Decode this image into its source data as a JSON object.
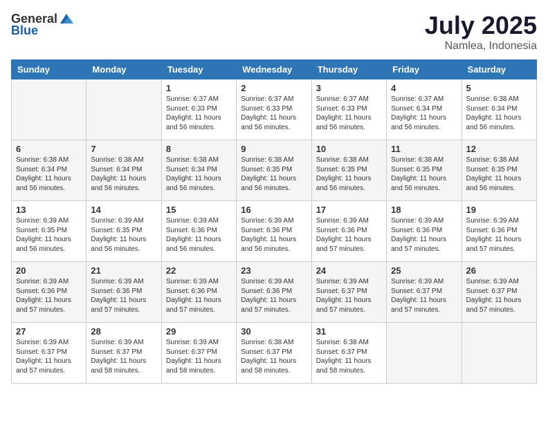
{
  "header": {
    "logo_general": "General",
    "logo_blue": "Blue",
    "month": "July 2025",
    "location": "Namlea, Indonesia"
  },
  "weekdays": [
    "Sunday",
    "Monday",
    "Tuesday",
    "Wednesday",
    "Thursday",
    "Friday",
    "Saturday"
  ],
  "weeks": [
    [
      {
        "day": "",
        "info": ""
      },
      {
        "day": "",
        "info": ""
      },
      {
        "day": "1",
        "info": "Sunrise: 6:37 AM\nSunset: 6:33 PM\nDaylight: 11 hours and 56 minutes."
      },
      {
        "day": "2",
        "info": "Sunrise: 6:37 AM\nSunset: 6:33 PM\nDaylight: 11 hours and 56 minutes."
      },
      {
        "day": "3",
        "info": "Sunrise: 6:37 AM\nSunset: 6:33 PM\nDaylight: 11 hours and 56 minutes."
      },
      {
        "day": "4",
        "info": "Sunrise: 6:37 AM\nSunset: 6:34 PM\nDaylight: 11 hours and 56 minutes."
      },
      {
        "day": "5",
        "info": "Sunrise: 6:38 AM\nSunset: 6:34 PM\nDaylight: 11 hours and 56 minutes."
      }
    ],
    [
      {
        "day": "6",
        "info": "Sunrise: 6:38 AM\nSunset: 6:34 PM\nDaylight: 11 hours and 56 minutes."
      },
      {
        "day": "7",
        "info": "Sunrise: 6:38 AM\nSunset: 6:34 PM\nDaylight: 11 hours and 56 minutes."
      },
      {
        "day": "8",
        "info": "Sunrise: 6:38 AM\nSunset: 6:34 PM\nDaylight: 11 hours and 56 minutes."
      },
      {
        "day": "9",
        "info": "Sunrise: 6:38 AM\nSunset: 6:35 PM\nDaylight: 11 hours and 56 minutes."
      },
      {
        "day": "10",
        "info": "Sunrise: 6:38 AM\nSunset: 6:35 PM\nDaylight: 11 hours and 56 minutes."
      },
      {
        "day": "11",
        "info": "Sunrise: 6:38 AM\nSunset: 6:35 PM\nDaylight: 11 hours and 56 minutes."
      },
      {
        "day": "12",
        "info": "Sunrise: 6:38 AM\nSunset: 6:35 PM\nDaylight: 11 hours and 56 minutes."
      }
    ],
    [
      {
        "day": "13",
        "info": "Sunrise: 6:39 AM\nSunset: 6:35 PM\nDaylight: 11 hours and 56 minutes."
      },
      {
        "day": "14",
        "info": "Sunrise: 6:39 AM\nSunset: 6:35 PM\nDaylight: 11 hours and 56 minutes."
      },
      {
        "day": "15",
        "info": "Sunrise: 6:39 AM\nSunset: 6:36 PM\nDaylight: 11 hours and 56 minutes."
      },
      {
        "day": "16",
        "info": "Sunrise: 6:39 AM\nSunset: 6:36 PM\nDaylight: 11 hours and 56 minutes."
      },
      {
        "day": "17",
        "info": "Sunrise: 6:39 AM\nSunset: 6:36 PM\nDaylight: 11 hours and 57 minutes."
      },
      {
        "day": "18",
        "info": "Sunrise: 6:39 AM\nSunset: 6:36 PM\nDaylight: 11 hours and 57 minutes."
      },
      {
        "day": "19",
        "info": "Sunrise: 6:39 AM\nSunset: 6:36 PM\nDaylight: 11 hours and 57 minutes."
      }
    ],
    [
      {
        "day": "20",
        "info": "Sunrise: 6:39 AM\nSunset: 6:36 PM\nDaylight: 11 hours and 57 minutes."
      },
      {
        "day": "21",
        "info": "Sunrise: 6:39 AM\nSunset: 6:36 PM\nDaylight: 11 hours and 57 minutes."
      },
      {
        "day": "22",
        "info": "Sunrise: 6:39 AM\nSunset: 6:36 PM\nDaylight: 11 hours and 57 minutes."
      },
      {
        "day": "23",
        "info": "Sunrise: 6:39 AM\nSunset: 6:36 PM\nDaylight: 11 hours and 57 minutes."
      },
      {
        "day": "24",
        "info": "Sunrise: 6:39 AM\nSunset: 6:37 PM\nDaylight: 11 hours and 57 minutes."
      },
      {
        "day": "25",
        "info": "Sunrise: 6:39 AM\nSunset: 6:37 PM\nDaylight: 11 hours and 57 minutes."
      },
      {
        "day": "26",
        "info": "Sunrise: 6:39 AM\nSunset: 6:37 PM\nDaylight: 11 hours and 57 minutes."
      }
    ],
    [
      {
        "day": "27",
        "info": "Sunrise: 6:39 AM\nSunset: 6:37 PM\nDaylight: 11 hours and 57 minutes."
      },
      {
        "day": "28",
        "info": "Sunrise: 6:39 AM\nSunset: 6:37 PM\nDaylight: 11 hours and 58 minutes."
      },
      {
        "day": "29",
        "info": "Sunrise: 6:39 AM\nSunset: 6:37 PM\nDaylight: 11 hours and 58 minutes."
      },
      {
        "day": "30",
        "info": "Sunrise: 6:38 AM\nSunset: 6:37 PM\nDaylight: 11 hours and 58 minutes."
      },
      {
        "day": "31",
        "info": "Sunrise: 6:38 AM\nSunset: 6:37 PM\nDaylight: 11 hours and 58 minutes."
      },
      {
        "day": "",
        "info": ""
      },
      {
        "day": "",
        "info": ""
      }
    ]
  ]
}
